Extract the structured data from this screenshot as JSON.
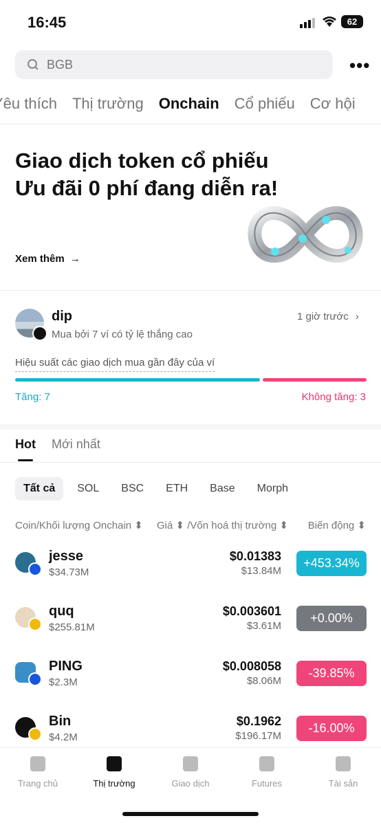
{
  "status": {
    "time": "16:45",
    "battery": "62"
  },
  "search": {
    "placeholder": "BGB"
  },
  "tabs": [
    "Yêu thích",
    "Thị trường",
    "Onchain",
    "Cổ phiếu",
    "Cơ hội"
  ],
  "active_tab": "Onchain",
  "promo": {
    "line1": "Giao dịch token cổ phiếu",
    "line2": "Ưu đãi 0 phí đang diễn ra!",
    "more": "Xem thêm"
  },
  "card": {
    "name": "dip",
    "subtitle": "Mua bởi 7 ví có tỷ lệ thắng cao",
    "time": "1 giờ trước",
    "perf_label": "Hiệu suất các giao dịch mua gần đây của ví",
    "up_label": "Tăng: 7",
    "down_label": "Không tăng: 3",
    "up_count": 7,
    "down_count": 3
  },
  "subtabs": [
    "Hot",
    "Mới nhất"
  ],
  "chips": [
    "Tất cả",
    "SOL",
    "BSC",
    "ETH",
    "Base",
    "Morph"
  ],
  "columns": {
    "coin": "Coin/Khối lượng Onchain ⬍",
    "price": "Giá ⬍ /Vốn hoá thị trường ⬍",
    "change": "Biến động ⬍"
  },
  "rows": [
    {
      "name": "jesse",
      "volume": "$34.73M",
      "price": "$0.01383",
      "cap": "$13.84M",
      "change": "+453.34%",
      "color": "#19b6d2"
    },
    {
      "name": "quq",
      "volume": "$255.81M",
      "price": "$0.003601",
      "cap": "$3.61M",
      "change": "+0.00%",
      "color": "#75787e"
    },
    {
      "name": "PING",
      "volume": "$2.3M",
      "price": "$0.008058",
      "cap": "$8.06M",
      "change": "-39.85%",
      "color": "#f0457a"
    },
    {
      "name": "Bin",
      "volume": "$4.2M",
      "price": "$0.1962",
      "cap": "$196.17M",
      "change": "-16.00%",
      "color": "#f0457a"
    }
  ],
  "nav": [
    {
      "label": "Trang chủ",
      "icon": "home-icon"
    },
    {
      "label": "Thị trường",
      "icon": "chart-icon"
    },
    {
      "label": "Giao dịch",
      "icon": "trade-icon"
    },
    {
      "label": "Futures",
      "icon": "futures-icon"
    },
    {
      "label": "Tài sản",
      "icon": "wallet-icon"
    }
  ]
}
